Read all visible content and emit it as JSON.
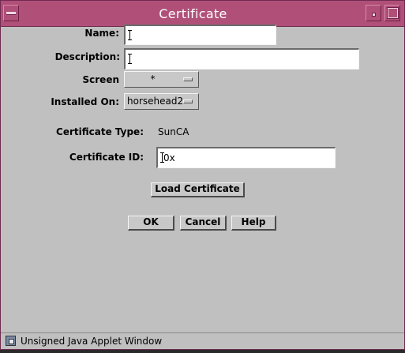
{
  "window": {
    "title": "Certificate",
    "status_text": "Unsigned Java Applet Window"
  },
  "form": {
    "name_label": "Name:",
    "name_value": "",
    "description_label": "Description:",
    "description_value": "",
    "screen_label": "Screen",
    "screen_value": "*",
    "installed_on_label": "Installed On:",
    "installed_on_value": "horsehead2",
    "cert_type_label": "Certificate Type:",
    "cert_type_value": "SunCA",
    "cert_id_label": "Certificate ID:",
    "cert_id_value": "0x"
  },
  "buttons": {
    "load_certificate": "Load Certificate",
    "ok": "OK",
    "cancel": "Cancel",
    "help": "Help"
  },
  "icons": {
    "window_menu": "window-menu-icon",
    "minimize": "minimize-icon",
    "maximize": "maximize-icon",
    "applet_warning": "applet-warning-icon"
  },
  "colors": {
    "titlebar": "#b05079",
    "window_bg": "#c0c0c0",
    "field_bg": "#ffffff"
  }
}
